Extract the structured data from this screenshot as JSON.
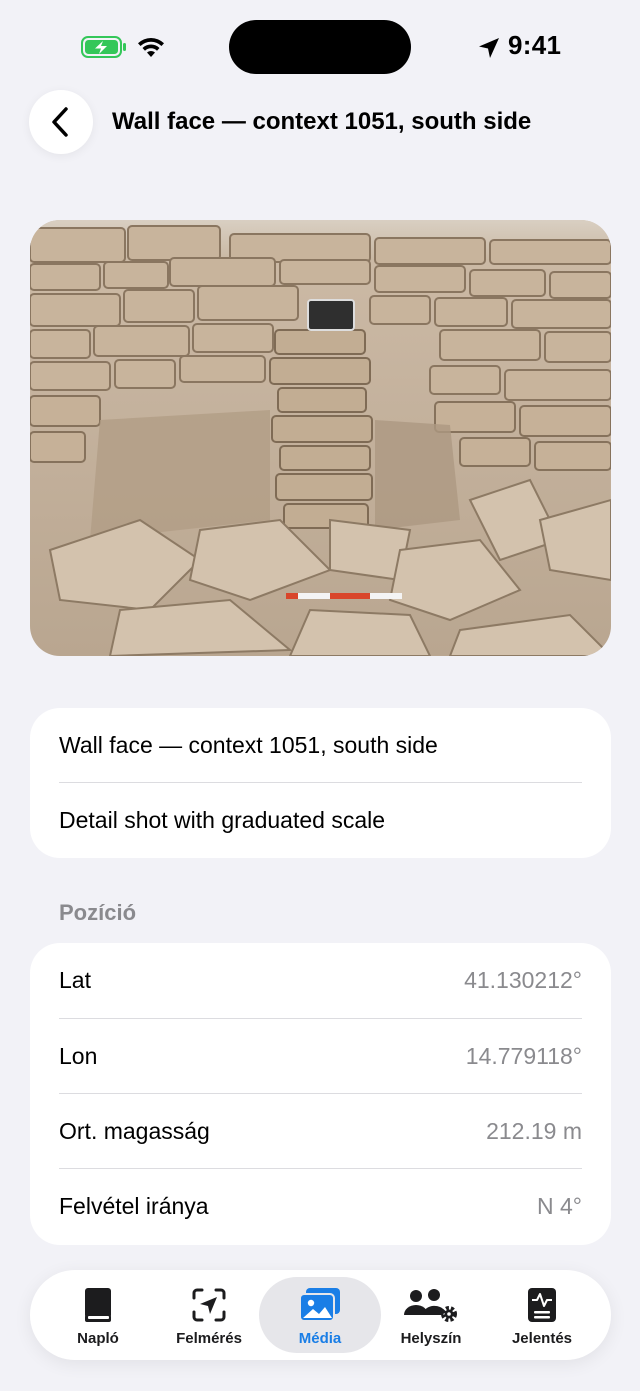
{
  "status_bar": {
    "time": "9:41",
    "icons": [
      "battery-charging-icon",
      "wifi-icon",
      "location-arrow-icon"
    ]
  },
  "header": {
    "title": "Wall face — context 1051, south side",
    "back_icon": "chevron-left-icon"
  },
  "photo": {
    "subject": "stone-wall-photo"
  },
  "description_card": {
    "title": "Wall face — context 1051, south side",
    "caption": "Detail shot with graduated scale"
  },
  "position": {
    "section_label": "Pozíció",
    "rows": [
      {
        "label": "Lat",
        "value": "41.130212°"
      },
      {
        "label": "Lon",
        "value": "14.779118°"
      },
      {
        "label": "Ort. magasság",
        "value": "212.19 m"
      },
      {
        "label": "Felvétel iránya",
        "value": "N 4°"
      }
    ]
  },
  "tab_bar": {
    "tabs": [
      {
        "label": "Napló",
        "icon": "book-icon"
      },
      {
        "label": "Felmérés",
        "icon": "survey-viewfinder-icon"
      },
      {
        "label": "Média",
        "icon": "photos-icon"
      },
      {
        "label": "Helyszín",
        "icon": "people-gear-icon"
      },
      {
        "label": "Jelentés",
        "icon": "report-icon"
      }
    ],
    "active": "Média"
  },
  "colors": {
    "accent": "#1a7ee6",
    "background": "#f2f2f7",
    "secondary_text": "#8a8a8e",
    "battery": "#34c759"
  }
}
